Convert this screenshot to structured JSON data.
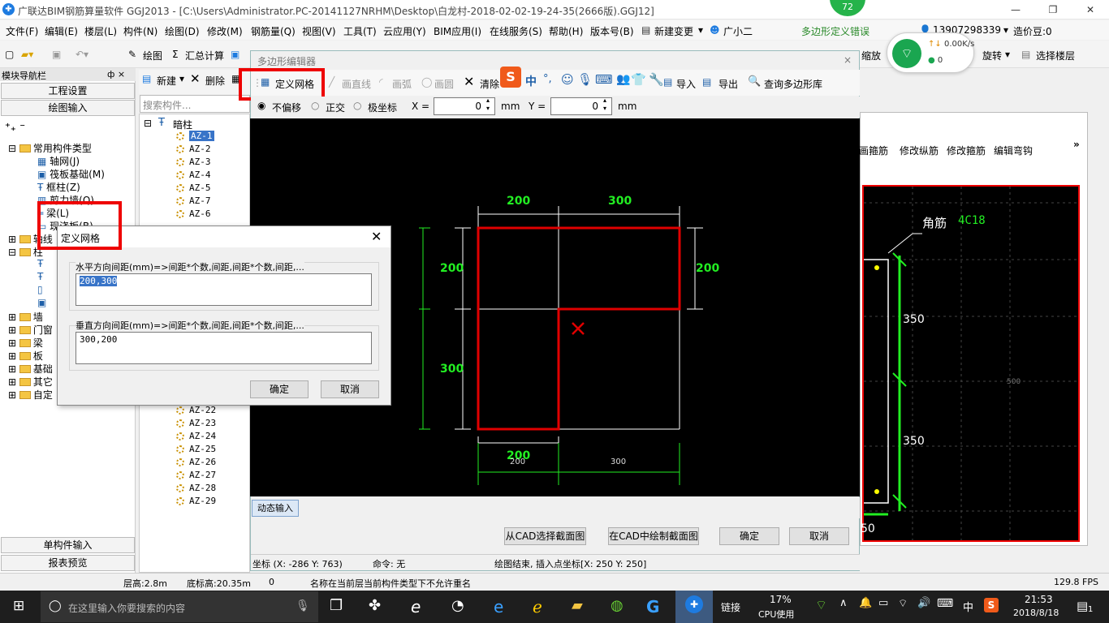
{
  "window": {
    "title": "广联达BIM钢筋算量软件 GGJ2013 - [C:\\Users\\Administrator.PC-20141127NRHM\\Desktop\\白龙村-2018-02-02-19-24-35(2666版).GGJ12]",
    "icon": "app-logo-icon",
    "badge": "72"
  },
  "menu": [
    "文件(F)",
    "编辑(E)",
    "楼层(L)",
    "构件(N)",
    "绘图(D)",
    "修改(M)",
    "钢筋量(Q)",
    "视图(V)",
    "工具(T)",
    "云应用(Y)",
    "BIM应用(I)",
    "在线服务(S)",
    "帮助(H)",
    "版本号(B)",
    "新建变更",
    "广小二"
  ],
  "menu_right": {
    "error": "多边形定义错误",
    "phone": "13907298339",
    "price": "造价豆:0"
  },
  "toolbar": {
    "draw": "绘图",
    "sum": "汇总计算",
    "zoom": "缩放",
    "rotate": "旋转",
    "select_floor": "选择楼层"
  },
  "netspeed": {
    "up": "0.00K/s",
    "down": "0"
  },
  "nav": {
    "header": "模块导航栏",
    "pin": "ф ×",
    "btn_settings": "工程设置",
    "btn_draw": "绘图输入",
    "tree": [
      {
        "label": "常用构件类型"
      },
      {
        "label": "轴网(J)"
      },
      {
        "label": "筏板基础(M)"
      },
      {
        "label": "框柱(Z)"
      },
      {
        "label": "剪力墙(Q)"
      },
      {
        "label": "梁(L)"
      },
      {
        "label": "现浇板(B)"
      },
      {
        "label": "轴线"
      },
      {
        "label": "柱"
      },
      {
        "label": "墙"
      },
      {
        "label": "门窗"
      },
      {
        "label": "梁"
      },
      {
        "label": "板"
      },
      {
        "label": "基础"
      },
      {
        "label": "其它"
      },
      {
        "label": "自定"
      }
    ],
    "btn_single": "单构件输入",
    "btn_report": "报表预览"
  },
  "mid": {
    "new": "新建",
    "delete": "删除",
    "search_placeholder": "搜索构件...",
    "root": "暗柱",
    "items": [
      "AZ-1",
      "AZ-2",
      "AZ-3",
      "AZ-4",
      "AZ-5",
      "AZ-7",
      "AZ-6",
      "AZ-22",
      "AZ-23",
      "AZ-24",
      "AZ-25",
      "AZ-26",
      "AZ-27",
      "AZ-28",
      "AZ-29"
    ]
  },
  "editor": {
    "title": "多边形编辑器",
    "tools": {
      "grid": "定义网格",
      "line": "画直线",
      "arc": "画弧",
      "circle": "画圆",
      "clear": "清除",
      "import": "导入",
      "export": "导出",
      "query": "查询多边形库"
    },
    "ime": "中",
    "mode": {
      "none": "不偏移",
      "ortho": "正交",
      "polar": "极坐标"
    },
    "x_label": "X =",
    "x_val": "0",
    "y_label": "Y =",
    "y_val": "0",
    "unit": "mm",
    "dims": {
      "top1": "200",
      "top2": "300",
      "right": "200",
      "left1": "200",
      "left2": "300",
      "bottom": "200",
      "bottom_w1": "200",
      "bottom_w2": "300"
    },
    "dyn_input": "动态输入",
    "btn_cad_select": "从CAD选择截面图",
    "btn_cad_draw": "在CAD中绘制截面图",
    "btn_ok": "确定",
    "btn_cancel": "取消",
    "status_coord": "坐标 (X: -286 Y: 763)",
    "status_cmd": "命令: 无",
    "status_msg": "绘图结束, 插入点坐标[X: 250 Y: 250]"
  },
  "right": {
    "tabs": [
      "画箍筋",
      "修改纵筋",
      "修改箍筋",
      "编辑弯钩"
    ],
    "corner": "角筋",
    "corner_val": "4C18",
    "d1": "350",
    "d2": "350",
    "d3": "50",
    "small": "500"
  },
  "dialog": {
    "title": "定义网格",
    "h_label": "水平方向间距(mm)=>间距*个数,间距,间距*个数,间距,...",
    "h_value": "200,300",
    "v_label": "垂直方向间距(mm)=>间距*个数,间距,间距*个数,间距,...",
    "v_value": "300,200",
    "ok": "确定",
    "cancel": "取消"
  },
  "status": {
    "floor_h": "层高:2.8m",
    "base_h": "底标高:20.35m",
    "zero": "0",
    "msg": "名称在当前层当前构件类型下不允许重名",
    "fps": "129.8 FPS"
  },
  "taskbar": {
    "search": "在这里输入你要搜索的内容",
    "link": "链接",
    "cpu": "17%",
    "cpu_label": "CPU使用",
    "ime": "中",
    "time": "21:53",
    "date": "2018/8/18",
    "notif": "1"
  },
  "colors": {
    "red": "#e00000",
    "green": "#22ee22",
    "cad_bg": "#000000",
    "title_blue": "#1e7be0"
  }
}
